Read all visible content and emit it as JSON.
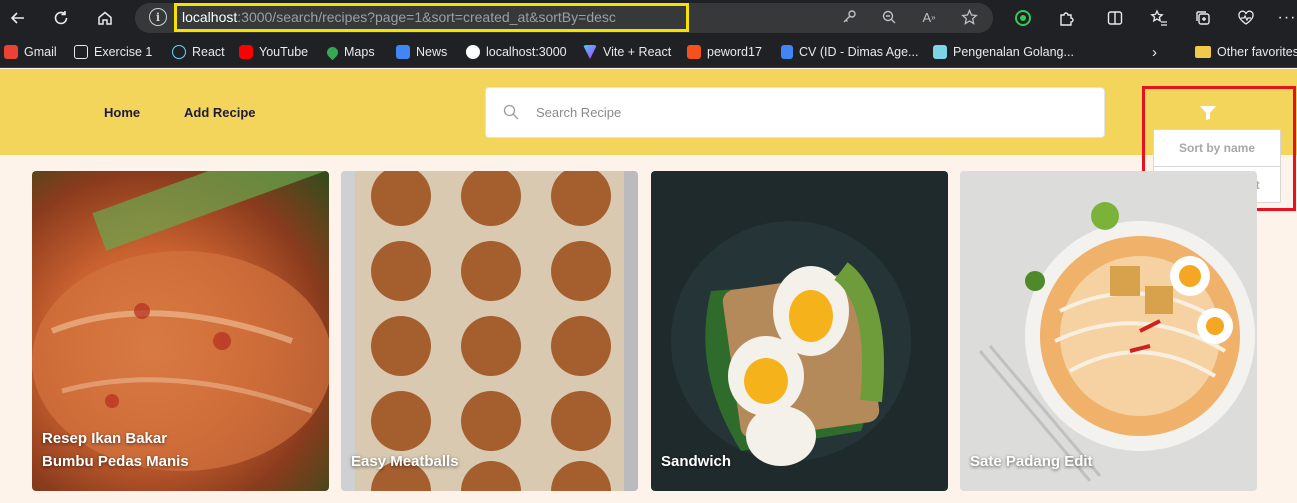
{
  "browser": {
    "url_host": "localhost",
    "url_rest": ":3000/search/recipes?page=1&sort=created_at&sortBy=desc",
    "bookmarks": [
      {
        "label": "Gmail",
        "color": "#ea4335"
      },
      {
        "label": "Exercise 1",
        "color": "#e8eaed"
      },
      {
        "label": "React",
        "color": "#61dafb"
      },
      {
        "label": "YouTube",
        "color": "#ff0000"
      },
      {
        "label": "Maps",
        "color": "#34a853"
      },
      {
        "label": "News",
        "color": "#4285f4"
      },
      {
        "label": "localhost:3000",
        "color": "#ffffff"
      },
      {
        "label": "Vite + React",
        "color": "#bd34fe"
      },
      {
        "label": "peword17",
        "color": "#f4511e"
      },
      {
        "label": "CV (ID - Dimas Age...",
        "color": "#4285f4"
      },
      {
        "label": "Pengenalan Golang...",
        "color": "#7fd3e6"
      },
      {
        "label": "Other favorites",
        "color": "#f2c94c"
      }
    ]
  },
  "header": {
    "nav": [
      "Home",
      "Add Recipe"
    ],
    "search_placeholder": "Search Recipe",
    "brand_color": "#f3d55b"
  },
  "sort_menu": {
    "items": [
      "Sort by name",
      "Sort by newest"
    ]
  },
  "recipes": [
    {
      "title": "Resep Ikan Bakar Bumbu Pedas Manis"
    },
    {
      "title": "Easy Meatballs"
    },
    {
      "title": "Sandwich"
    },
    {
      "title": "Sate Padang Edit"
    }
  ]
}
